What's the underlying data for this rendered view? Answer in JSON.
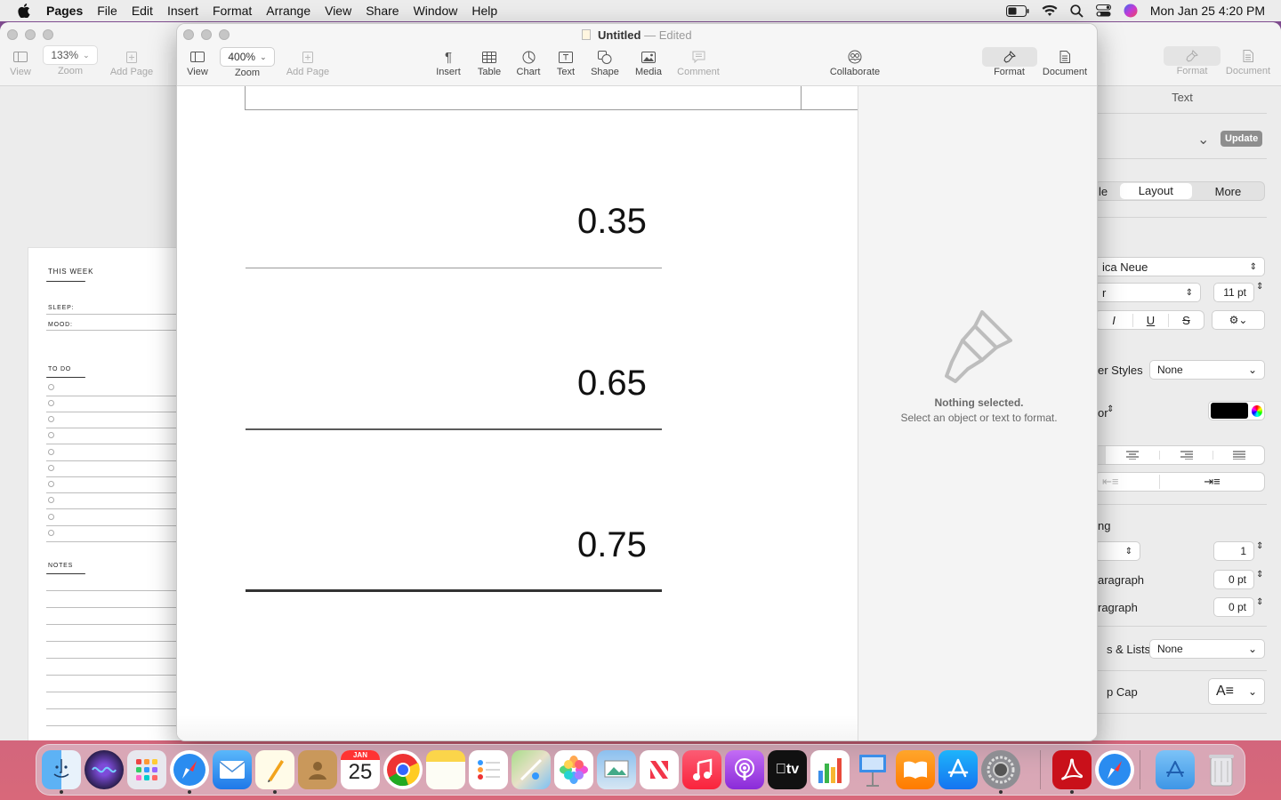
{
  "menubar": {
    "apple": "",
    "app_name": "Pages",
    "items": [
      "File",
      "Edit",
      "Insert",
      "Format",
      "Arrange",
      "View",
      "Share",
      "Window",
      "Help"
    ],
    "clock": "Mon Jan 25  4:20 PM"
  },
  "back_window": {
    "toolbar": {
      "view": "View",
      "zoom": "Zoom",
      "zoom_value": "133%",
      "add_page": "Add Page",
      "format": "Format",
      "document": "Document"
    },
    "page": {
      "this_week": "THIS WEEK",
      "sleep": "SLEEP:",
      "mood": "MOOD:",
      "todo": "TO DO",
      "notes": "NOTES"
    },
    "sidebar": {
      "title": "Text",
      "update": "Update",
      "tab_style_partial": "le",
      "tab_layout": "Layout",
      "tab_more": "More",
      "font_partial": "ica Neue",
      "typeface_partial": "r",
      "size": "11 pt",
      "italic": "I",
      "underline": "U",
      "strike": "S",
      "char_styles_partial": "er Styles",
      "char_styles_value": "None",
      "color_partial": "or",
      "color_value": "#000000",
      "spacing_partial": "ng",
      "spacing_value": "1",
      "before_partial": "aragraph",
      "before_value": "0 pt",
      "after_partial": "ragraph",
      "after_value": "0 pt",
      "lists_partial": "s & Lists",
      "lists_value": "None",
      "dropcap_partial": "p Cap"
    }
  },
  "front_window": {
    "title": "Untitled",
    "title_sep": "—",
    "edited": "Edited",
    "toolbar": {
      "view": "View",
      "zoom": "Zoom",
      "zoom_value": "400%",
      "add_page": "Add Page",
      "insert": "Insert",
      "table": "Table",
      "chart": "Chart",
      "text": "Text",
      "shape": "Shape",
      "media": "Media",
      "comment": "Comment",
      "collaborate": "Collaborate",
      "format": "Format",
      "document": "Document"
    },
    "document": {
      "values": [
        "0.35",
        "0.65",
        "0.75"
      ]
    },
    "inspector": {
      "nothing_selected": "Nothing selected.",
      "hint": "Select an object or text to format."
    }
  },
  "dock": {
    "calendar_month": "JAN",
    "calendar_day": "25",
    "tv_label": "tv",
    "apps": [
      "finder-icon",
      "siri-icon",
      "launchpad-icon",
      "safari-icon",
      "mail-icon",
      "pages-icon",
      "contacts-icon",
      "calendar-icon",
      "chrome-icon",
      "notes-icon",
      "reminders-icon",
      "maps-icon",
      "photos-icon",
      "preview-icon",
      "news-icon",
      "music-icon",
      "podcasts-icon",
      "tv-icon",
      "numbers-icon",
      "keynote-icon",
      "books-icon",
      "app-store-icon",
      "system-preferences-icon",
      "acrobat-icon",
      "safari-alt-icon",
      "downloads-folder-icon",
      "trash-icon"
    ]
  }
}
